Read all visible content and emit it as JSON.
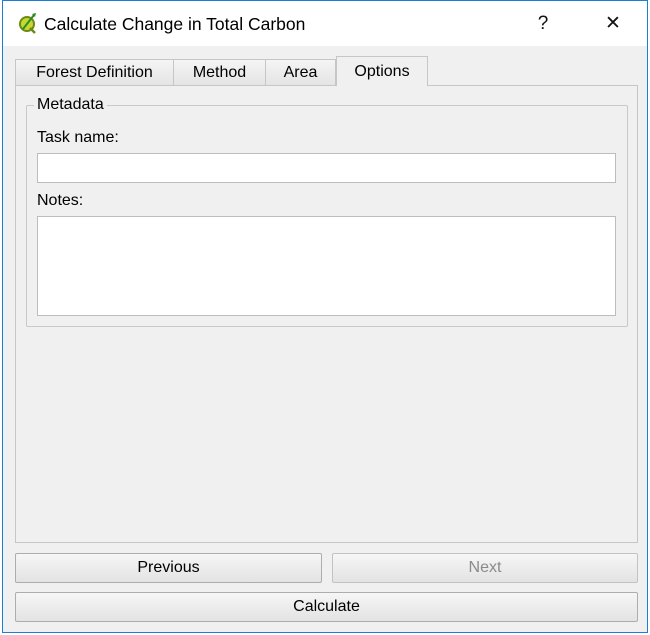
{
  "window": {
    "title": "Calculate Change in Total Carbon",
    "help_label": "?",
    "close_label": "✕",
    "icon": "qgis-icon",
    "border_color": "#1c7fd6"
  },
  "tabs": [
    {
      "label": "Forest Definition",
      "selected": false
    },
    {
      "label": "Method",
      "selected": false
    },
    {
      "label": "Area",
      "selected": false
    },
    {
      "label": "Options",
      "selected": true
    }
  ],
  "metadata": {
    "group_title": "Metadata",
    "task_name_label": "Task name:",
    "task_name_value": "",
    "notes_label": "Notes:",
    "notes_value": ""
  },
  "buttons": {
    "previous": "Previous",
    "next": "Next",
    "next_enabled": false,
    "calculate": "Calculate"
  }
}
